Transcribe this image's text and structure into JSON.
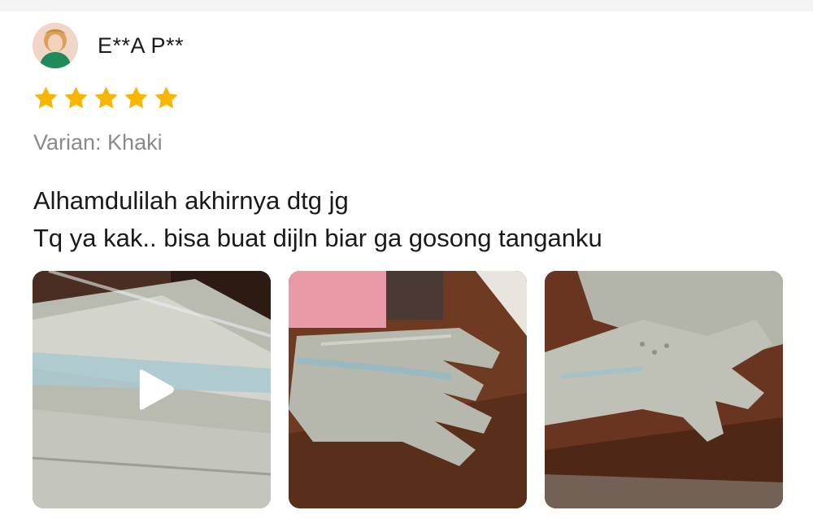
{
  "reviewer": {
    "name": "E**A P**",
    "avatar_icon": "avatar-photo"
  },
  "rating": {
    "stars": 5,
    "max": 5,
    "color": "#f7b500"
  },
  "variant": {
    "text": "Varian: Khaki"
  },
  "comment": {
    "lines": [
      "Alhamdulilah akhirnya dtg jg",
      "Tq ya kak.. bisa buat dijln biar ga gosong tanganku"
    ]
  },
  "media": [
    {
      "kind": "video",
      "icon": "play-icon"
    },
    {
      "kind": "photo"
    },
    {
      "kind": "photo"
    }
  ]
}
